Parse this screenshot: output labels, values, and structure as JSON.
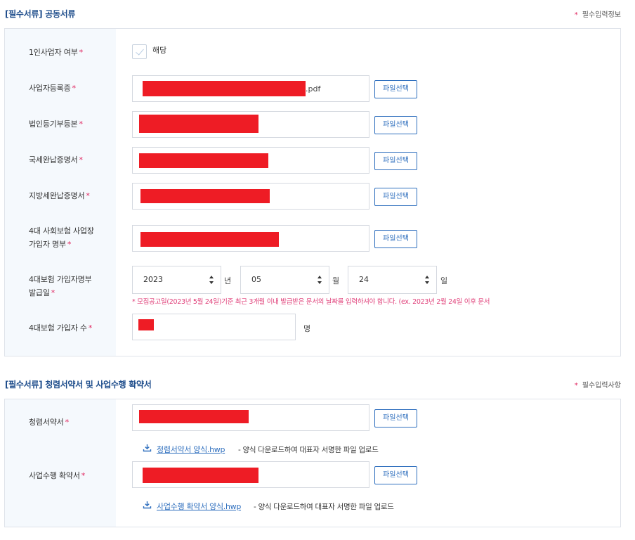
{
  "section1": {
    "title": "[필수서류] 공동서류",
    "req_note": "필수입력정보",
    "req_star": "*",
    "rows": {
      "solo": {
        "label": "1인사업자 여부",
        "checkbox_label": "해당",
        "checked": false
      },
      "bizreg": {
        "label": "사업자등록증",
        "file_suffix": ".pdf",
        "button": "파일선택"
      },
      "corpreg": {
        "label": "법인등기부등본",
        "button": "파일선택"
      },
      "taxcert": {
        "label": "국세완납증명서",
        "button": "파일선택"
      },
      "localtax": {
        "label": "지방세완납증명서",
        "button": "파일선택"
      },
      "insurance": {
        "label_line1": "4대 사회보험 사업장",
        "label_line2": "가입자 명부",
        "button": "파일선택"
      },
      "issue_date": {
        "label_line1": "4대보험 가입자명부",
        "label_line2": "발급일",
        "year": "2023",
        "year_unit": "년",
        "month": "05",
        "month_unit": "월",
        "day": "24",
        "day_unit": "일",
        "notice": "* 모집공고일(2023년 5월 24일)기준 최근 3개월 이내 발급받은 문서의 날짜를 입력하셔야 합니다. (ex. 2023년 2월 24일 이후 문서"
      },
      "members": {
        "label": "4대보험 가입자 수",
        "unit": "명"
      }
    }
  },
  "section2": {
    "title": "[필수서류] 청렴서약서 및 사업수행 확약서",
    "req_note": "필수입력사항",
    "req_star": "*",
    "rows": {
      "pledge": {
        "label": "청렴서약서",
        "button": "파일선택",
        "download_link": "청렴서약서 양식.hwp",
        "download_desc": "- 양식 다운로드하여 대표자 서명한 파일 업로드"
      },
      "commit": {
        "label": "사업수행 확약서",
        "button": "파일선택",
        "download_link": "사업수행 확약서 양식.hwp",
        "download_desc": "- 양식 다운로드하여 대표자 서명한 파일 업로드"
      }
    }
  },
  "colors": {
    "accent": "#2f6fbe",
    "required": "#e0245e",
    "notice": "#e0407a",
    "redaction": "#ee1c25"
  },
  "icons": {
    "download": "download-icon"
  }
}
